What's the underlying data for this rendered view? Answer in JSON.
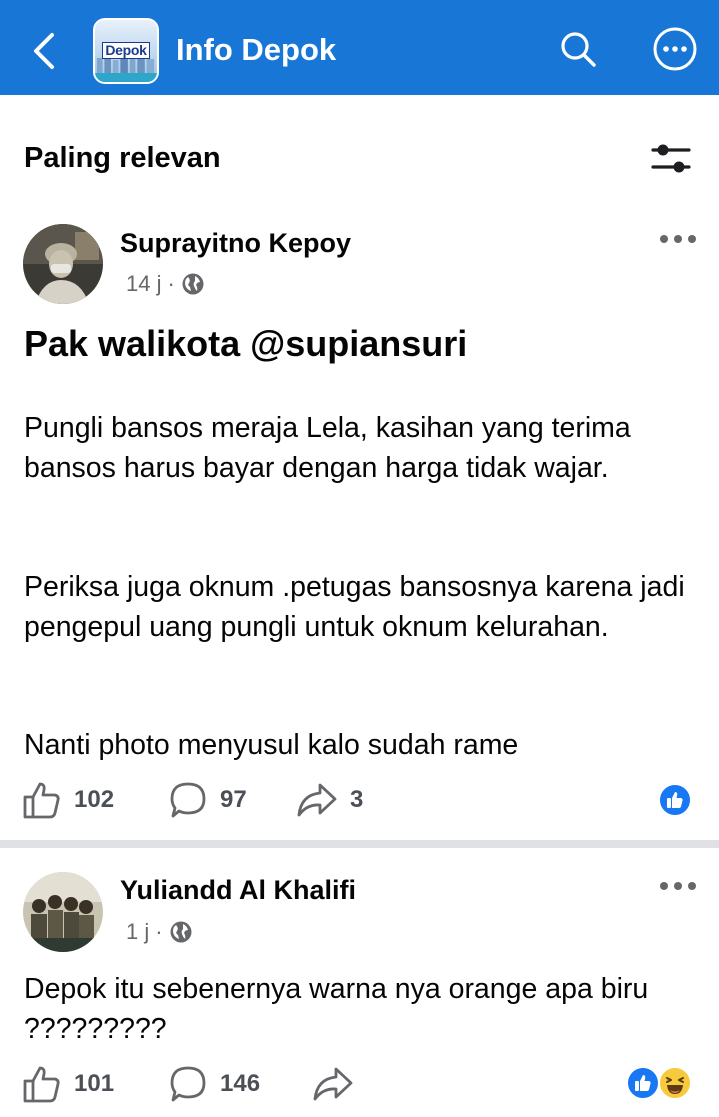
{
  "header": {
    "group_logo_text": "Depok",
    "group_name": "Info Depok",
    "icons": {
      "back": "arrow-left-icon",
      "search": "search-icon",
      "more": "more-circle-icon"
    },
    "bar_color": "#1877d6"
  },
  "sort": {
    "label": "Paling relevan",
    "filter_icon": "sliders-icon"
  },
  "posts": [
    {
      "author": "Suprayitno Kepoy",
      "time": "14 j",
      "separator": "·",
      "privacy_icon": "globe-icon",
      "title": "Pak walikota @supiansuri",
      "paragraphs": [
        "Pungli bansos meraja Lela, kasihan yang terima bansos harus bayar dengan harga tidak wajar.",
        "Periksa juga oknum .petugas bansosnya karena jadi pengepul uang pungli untuk oknum kelurahan.",
        "Nanti photo menyusul kalo sudah rame"
      ],
      "likes": "102",
      "comments": "97",
      "shares": "3",
      "reactions": [
        "like"
      ]
    },
    {
      "author": "Yuliandd Al Khalifi",
      "time": "1 j",
      "separator": "·",
      "privacy_icon": "globe-icon",
      "paragraphs": [
        "Depok itu sebenernya warna nya orange apa biru ?????????"
      ],
      "likes": "101",
      "comments": "146",
      "reactions": [
        "like",
        "haha"
      ]
    }
  ],
  "colors": {
    "text_primary": "#050505",
    "text_secondary": "#65676b",
    "like_blue": "#1877f2",
    "haha_yellow": "#f7c93c"
  }
}
